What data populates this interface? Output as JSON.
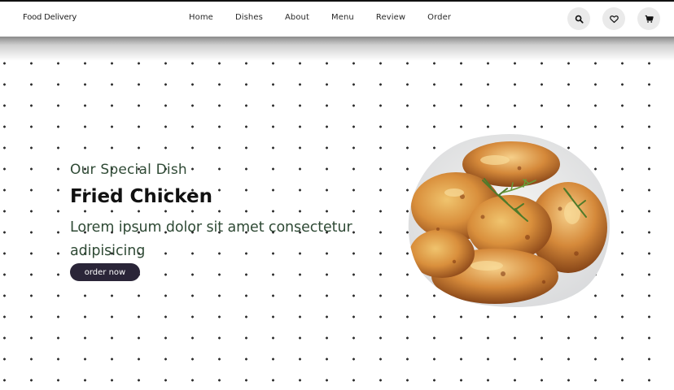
{
  "header": {
    "logo": "Food Delivery",
    "nav": [
      "Home",
      "Dishes",
      "About",
      "Menu",
      "Review",
      "Order"
    ],
    "icons": [
      "search-icon",
      "heart-icon",
      "cart-icon"
    ]
  },
  "hero": {
    "subtitle": "Our Special Dish",
    "title": "Fried Chicken",
    "text": "Lorem ipsum dolor sit amet consectetur adipisicing",
    "button": "order now"
  },
  "colors": {
    "accent_green": "#2f4a35",
    "button_dark": "#2a2538",
    "icon_bg": "#eaeaea"
  }
}
